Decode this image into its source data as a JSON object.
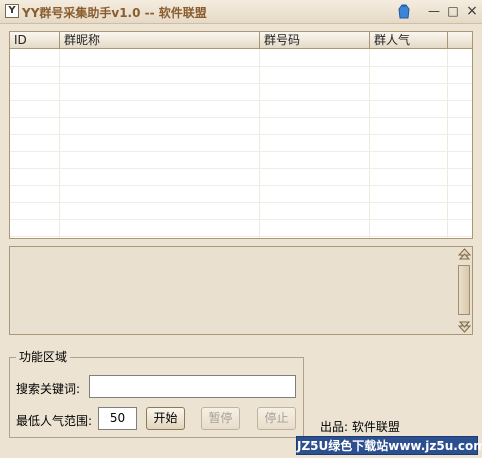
{
  "window": {
    "title": "YY群号采集助手v1.0  --  软件联盟",
    "app_icon_glyph": "Y",
    "controls": {
      "minimize": "—",
      "maximize": "□",
      "close": "×"
    }
  },
  "list": {
    "columns": [
      "ID",
      "群昵称",
      "群号码",
      "群人气"
    ],
    "rows": []
  },
  "log": {
    "lines": []
  },
  "function_area": {
    "title": "功能区域",
    "keyword_label": "搜索关键词:",
    "keyword_value": "",
    "min_popularity_label": "最低人气范围:",
    "min_popularity_value": "50",
    "start_label": "开始",
    "pause_label": "暂停",
    "stop_label": "停止"
  },
  "publisher_label": "出品: 软件联盟",
  "watermark": "JZ5U绿色下载站www.jz5u.com",
  "colors": {
    "title_text": "#8a5c2e",
    "watermark_bg": "#2c4f8f",
    "window_bg": "#ece3d3"
  }
}
